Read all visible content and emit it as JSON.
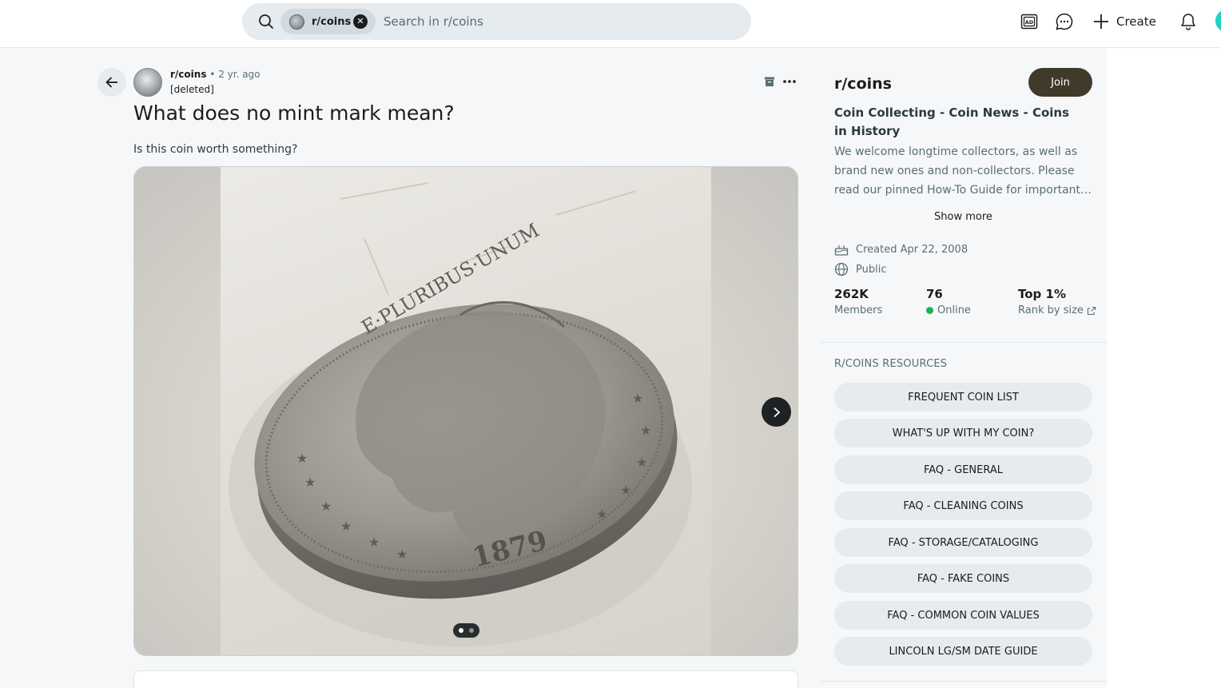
{
  "header": {
    "search_chip_label": "r/coins",
    "search_placeholder": "Search in r/coins",
    "create_label": "Create"
  },
  "post": {
    "subreddit": "r/coins",
    "age": "• 2 yr. ago",
    "author": "[deleted]",
    "title": "What does no mint mark mean?",
    "body": "Is this coin worth something?",
    "gallery": {
      "image_count": 2,
      "current_index": 1
    }
  },
  "sidebar": {
    "title": "r/coins",
    "join_label": "Join",
    "headline": "Coin Collecting - Coin News - Coins in History",
    "description": "We welcome longtime collectors, as well as brand new ones and non-collectors. Please read our pinned How-To Guide for important…",
    "show_more": "Show more",
    "created": "Created Apr 22, 2008",
    "visibility": "Public",
    "stats": [
      {
        "value": "262K",
        "label": "Members"
      },
      {
        "value": "76",
        "label": "Online"
      },
      {
        "value": "Top 1%",
        "label": "Rank by size"
      }
    ],
    "resources_title": "R/COINS RESOURCES",
    "resources": [
      "FREQUENT COIN LIST",
      "WHAT'S UP WITH MY COIN?",
      "FAQ - GENERAL",
      "FAQ - CLEANING COINS",
      "FAQ - STORAGE/CATALOGING",
      "FAQ - FAKE COINS",
      "FAQ - COMMON COIN VALUES",
      "LINCOLN LG/SM DATE GUIDE"
    ]
  },
  "colors": {
    "join_button": "#403a2b",
    "online_indicator": "#1fb053",
    "search_bg": "#e5ebee"
  },
  "icons": [
    "search-icon",
    "close-icon",
    "ad-icon",
    "chat-icon",
    "plus-icon",
    "bell-icon",
    "back-arrow-icon",
    "archive-icon",
    "more-icon",
    "chevron-right-icon",
    "cake-icon",
    "globe-icon",
    "external-link-icon"
  ]
}
